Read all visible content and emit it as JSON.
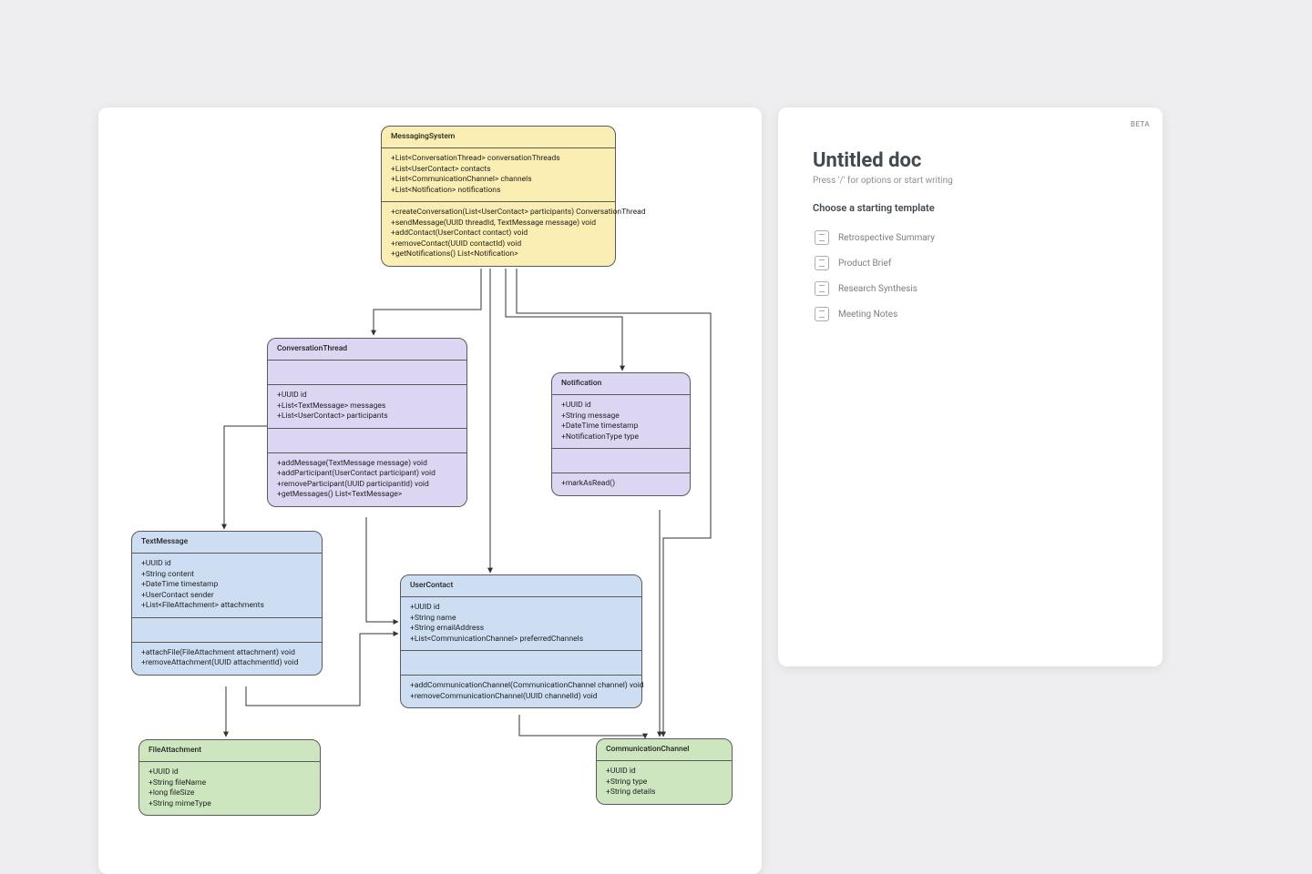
{
  "doc_panel": {
    "beta_badge": "BETA",
    "title": "Untitled doc",
    "hint": "Press '/' for options or start writing",
    "section_heading": "Choose a starting template",
    "templates": [
      "Retrospective Summary",
      "Product Brief",
      "Research Synthesis",
      "Meeting Notes"
    ]
  },
  "uml": {
    "MessagingSystem": {
      "color": "yellow",
      "attributes": [
        "+List<ConversationThread> conversationThreads",
        "+List<UserContact> contacts",
        "+List<CommunicationChannel> channels",
        "+List<Notification> notifications"
      ],
      "methods": [
        "+createConversation(List<UserContact> participants) ConversationThread",
        "+sendMessage(UUID threadId, TextMessage message) void",
        "+addContact(UserContact contact) void",
        "+removeContact(UUID contactId) void",
        "+getNotifications() List<Notification>"
      ]
    },
    "ConversationThread": {
      "color": "purple",
      "attributes": [
        "+UUID id",
        "+List<TextMessage> messages",
        "+List<UserContact> participants"
      ],
      "methods": [
        "+addMessage(TextMessage message) void",
        "+addParticipant(UserContact participant) void",
        "+removeParticipant(UUID participantId) void",
        "+getMessages() List<TextMessage>"
      ]
    },
    "Notification": {
      "color": "purple",
      "attributes": [
        "+UUID id",
        "+String message",
        "+DateTime timestamp",
        "+NotificationType type"
      ],
      "methods": [
        "+markAsRead()"
      ]
    },
    "TextMessage": {
      "color": "blue",
      "attributes": [
        "+UUID id",
        "+String content",
        "+DateTime timestamp",
        "+UserContact sender",
        "+List<FileAttachment> attachments"
      ],
      "methods": [
        "+attachFile(FileAttachment attachment) void",
        "+removeAttachment(UUID attachmentId) void"
      ]
    },
    "UserContact": {
      "color": "blue",
      "attributes": [
        "+UUID id",
        "+String name",
        "+String emailAddress",
        "+List<CommunicationChannel> preferredChannels"
      ],
      "methods": [
        "+addCommunicationChannel(CommunicationChannel channel) void",
        "+removeCommunicationChannel(UUID channelId) void"
      ]
    },
    "FileAttachment": {
      "color": "green",
      "attributes": [
        "+UUID id",
        "+String fileName",
        "+long fileSize",
        "+String mimeType"
      ],
      "methods": []
    },
    "CommunicationChannel": {
      "color": "green",
      "attributes": [
        "+UUID id",
        "+String type",
        "+String details"
      ],
      "methods": []
    }
  },
  "edges": [
    {
      "from": "MessagingSystem",
      "to": "ConversationThread"
    },
    {
      "from": "MessagingSystem",
      "to": "UserContact"
    },
    {
      "from": "MessagingSystem",
      "to": "CommunicationChannel"
    },
    {
      "from": "MessagingSystem",
      "to": "Notification"
    },
    {
      "from": "ConversationThread",
      "to": "TextMessage"
    },
    {
      "from": "ConversationThread",
      "to": "UserContact"
    },
    {
      "from": "TextMessage",
      "to": "UserContact"
    },
    {
      "from": "TextMessage",
      "to": "FileAttachment"
    },
    {
      "from": "UserContact",
      "to": "CommunicationChannel"
    },
    {
      "from": "Notification",
      "to": "CommunicationChannel"
    }
  ]
}
